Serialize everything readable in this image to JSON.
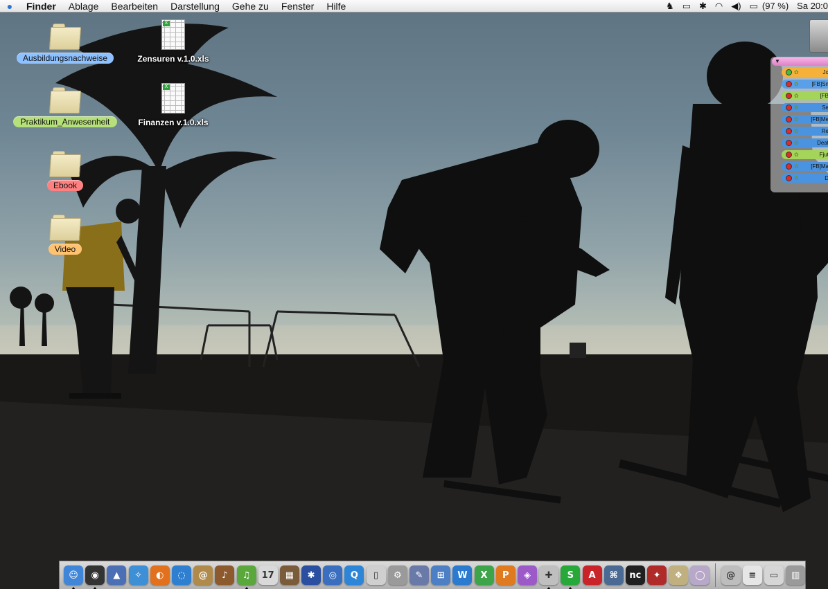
{
  "menubar": {
    "apple_icon": "apple-icon",
    "app_name": "Finder",
    "menus": [
      "Ablage",
      "Bearbeiten",
      "Darstellung",
      "Gehe zu",
      "Fenster",
      "Hilfe"
    ],
    "battery": "(97 %)",
    "clock": "Sa 20:0"
  },
  "desktop": {
    "folders": [
      {
        "label": "Ausbildungsnachweise",
        "color": "#8ec1ff"
      },
      {
        "label": "Praktikum_Anwesenheit",
        "color": "#b6e07a"
      },
      {
        "label": "Ebook",
        "color": "#ff8080"
      },
      {
        "label": "Video",
        "color": "#ffc26e"
      }
    ],
    "files": [
      {
        "label": "Zensuren v.1.0.xls",
        "badge": "X"
      },
      {
        "label": "Finanzen v.1.0.xls",
        "badge": "X"
      }
    ]
  },
  "buddy_list": {
    "header_arrow": "▼",
    "buddies": [
      {
        "name": "Jo",
        "status": "online",
        "color": "#f5b13a"
      },
      {
        "name": "[FB]Sn",
        "status": "away",
        "color": "#5aa0e8"
      },
      {
        "name": "[FB",
        "status": "away",
        "color": "#a4d45a"
      },
      {
        "name": "Se",
        "status": "away",
        "color": "#4a93e0"
      },
      {
        "name": "[FB]Me",
        "status": "away",
        "color": "#4a93e0"
      },
      {
        "name": "Re",
        "status": "away",
        "color": "#4a93e0"
      },
      {
        "name": "Deat",
        "status": "away",
        "color": "#4a93e0"
      },
      {
        "name": "Fjut",
        "status": "away",
        "color": "#a4d45a"
      },
      {
        "name": "[FB]Ma",
        "status": "away",
        "color": "#4a93e0"
      },
      {
        "name": "D",
        "status": "away",
        "color": "#4a93e0"
      }
    ]
  },
  "dock": {
    "apps": [
      {
        "icon": "finder-icon",
        "glyph": "☺",
        "color": "#3f86d9",
        "running": true
      },
      {
        "icon": "dashboard-icon",
        "glyph": "◉",
        "color": "#333333",
        "running": true
      },
      {
        "icon": "preview-icon",
        "glyph": "▲",
        "color": "#4a6fb5",
        "running": false
      },
      {
        "icon": "safari-icon",
        "glyph": "✧",
        "color": "#3d8fd6",
        "running": false
      },
      {
        "icon": "firefox-icon",
        "glyph": "◐",
        "color": "#e2711d",
        "running": false
      },
      {
        "icon": "ichat-icon",
        "glyph": "◌",
        "color": "#2f7fd0",
        "running": false
      },
      {
        "icon": "address-book-icon",
        "glyph": "@",
        "color": "#b08a4a",
        "running": false
      },
      {
        "icon": "garageband-icon",
        "glyph": "♪",
        "color": "#8c5a2c",
        "running": false
      },
      {
        "icon": "itunes-icon",
        "glyph": "♫",
        "color": "#5aa83c",
        "running": true
      },
      {
        "icon": "ical-icon",
        "glyph": "17",
        "color": "#d9d9d9",
        "running": false
      },
      {
        "icon": "iphoto-icon",
        "glyph": "▦",
        "color": "#7a5c3a",
        "running": false
      },
      {
        "icon": "imovie-icon",
        "glyph": "✱",
        "color": "#2b4fa0",
        "running": false
      },
      {
        "icon": "dvd-player-icon",
        "glyph": "◎",
        "color": "#3a6fc0",
        "running": false
      },
      {
        "icon": "quicktime-icon",
        "glyph": "Q",
        "color": "#2d85d8",
        "running": false
      },
      {
        "icon": "ipod-icon",
        "glyph": "▯",
        "color": "#cfcfcf",
        "running": false
      },
      {
        "icon": "system-preferences-icon",
        "glyph": "⚙",
        "color": "#9a9a9a",
        "running": false
      },
      {
        "icon": "script-editor-icon",
        "glyph": "✎",
        "color": "#6a7aa8",
        "running": false
      },
      {
        "icon": "network-icon",
        "glyph": "⊞",
        "color": "#4c7fc4",
        "running": false
      },
      {
        "icon": "word-icon",
        "glyph": "W",
        "color": "#2a7ad0",
        "running": false
      },
      {
        "icon": "excel-icon",
        "glyph": "X",
        "color": "#3ea44a",
        "running": false
      },
      {
        "icon": "powerpoint-icon",
        "glyph": "P",
        "color": "#e07a1e",
        "running": false
      },
      {
        "icon": "entourage-icon",
        "glyph": "◈",
        "color": "#9b5ac8",
        "running": false
      },
      {
        "icon": "messenger-icon",
        "glyph": "✚",
        "color": "#bfbfbf",
        "running": true
      },
      {
        "icon": "skype-icon",
        "glyph": "S",
        "color": "#29a83a",
        "running": true
      },
      {
        "icon": "acrobat-icon",
        "glyph": "A",
        "color": "#c8242a",
        "running": false
      },
      {
        "icon": "xcode-icon",
        "glyph": "⌘",
        "color": "#4a6a94",
        "running": false
      },
      {
        "icon": "nc-icon",
        "glyph": "nc",
        "color": "#202020",
        "running": false
      },
      {
        "icon": "adium-icon",
        "glyph": "✦",
        "color": "#b02a2a",
        "running": false
      },
      {
        "icon": "stuffit-icon",
        "glyph": "❖",
        "color": "#c0b080",
        "running": false
      },
      {
        "icon": "disc-icon",
        "glyph": "◯",
        "color": "#b8a8c8",
        "running": false
      }
    ],
    "trailing": [
      {
        "icon": "downloads-icon",
        "glyph": "@",
        "color": "#bdbdbd"
      },
      {
        "icon": "document-icon",
        "glyph": "≡",
        "color": "#e6e6e6"
      },
      {
        "icon": "window-icon",
        "glyph": "▭",
        "color": "#d6d6d6"
      },
      {
        "icon": "trash-icon",
        "glyph": "▥",
        "color": "#9a9a9a"
      }
    ]
  }
}
